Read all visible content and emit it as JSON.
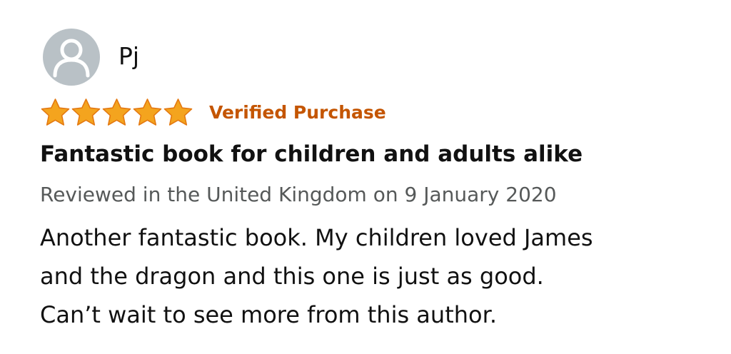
{
  "reviewer": {
    "name": "Pj",
    "avatar_icon": "user-silhouette-icon"
  },
  "rating": {
    "stars": 5,
    "max_stars": 5,
    "star_color": "#f4a41e",
    "star_outline_color": "#e47911"
  },
  "badge": {
    "label": "Verified Purchase",
    "color": "#c45500"
  },
  "review": {
    "title": "Fantastic book for children and adults alike",
    "meta": "Reviewed in the United Kingdom on 9 January 2020",
    "body_lines": [
      "Another fantastic book. My children loved James",
      "and the dragon and this one is just as good.",
      "Can’t wait to see more from this author."
    ]
  }
}
